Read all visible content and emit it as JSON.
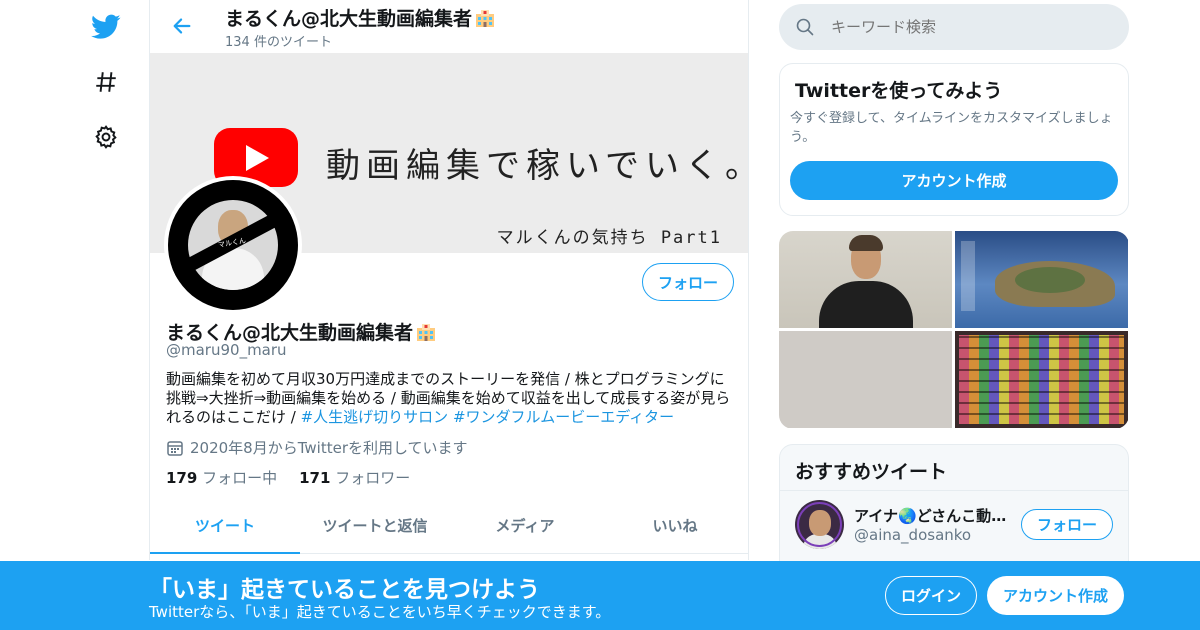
{
  "nav": {
    "items": [
      {
        "name": "twitter-logo-icon"
      },
      {
        "name": "hashtag-icon"
      },
      {
        "name": "gear-icon"
      }
    ]
  },
  "header": {
    "title": "まるくん@北大生動画編集者",
    "tweet_count": "134 件のツイート"
  },
  "banner": {
    "main_text": "動画編集で稼いでいく。",
    "sub_text": "マルくんの気持ち Part1"
  },
  "profile": {
    "avatar_label": "マルくん",
    "name": "まるくん@北大生動画編集者",
    "handle": "@maru90_maru",
    "bio_text": "動画編集を初めて月収30万円達成までのストーリーを発信 / 株とプログラミングに挑戦⇒大挫折⇒動画編集を始める / 動画編集を始めて収益を出して成長する姿が見られるのはここだけ / ",
    "bio_tag1": "#人生逃げ切りサロン",
    "bio_tag2": "#ワンダフルムービーエディター",
    "joined": "2020年8月からTwitterを利用しています",
    "following_count": "179",
    "following_label": "フォロー中",
    "followers_count": "171",
    "followers_label": "フォロワー",
    "follow_label": "フォロー"
  },
  "tabs": [
    {
      "label": "ツイート",
      "active": true
    },
    {
      "label": "ツイートと返信",
      "active": false
    },
    {
      "label": "メディア",
      "active": false
    },
    {
      "label": "いいね",
      "active": false
    }
  ],
  "search": {
    "placeholder": "キーワード検索"
  },
  "signup_box": {
    "title": "Twitterを使ってみよう",
    "description": "今すぐ登録して、タイムラインをカスタマイズしましょう。",
    "button_label": "アカウント作成"
  },
  "recommended": {
    "title": "おすすめツイート",
    "user_name": "アイナ🌏どさんこ動画クリエイター",
    "user_handle": "@aina_dosanko",
    "follow_label": "フォロー"
  },
  "bottom_bar": {
    "title": "「いま」起きていることを見つけよう",
    "subtitle": "Twitterなら、「いま」起きていることをいち早くチェックできます。",
    "login_label": "ログイン",
    "signup_label": "アカウント作成"
  },
  "colors": {
    "accent": "#1da1f2",
    "secondary_text": "#657786",
    "border": "#e6ecf0"
  }
}
